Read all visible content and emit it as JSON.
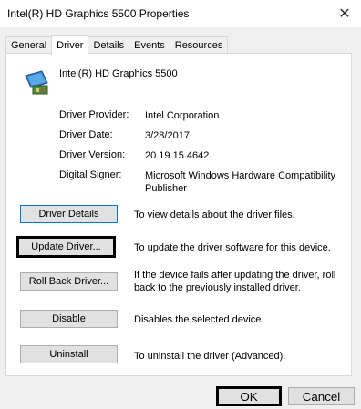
{
  "window": {
    "title": "Intel(R) HD Graphics 5500 Properties",
    "close_glyph": "✕"
  },
  "tabs": [
    {
      "label": "General",
      "active": false
    },
    {
      "label": "Driver",
      "active": true
    },
    {
      "label": "Details",
      "active": false
    },
    {
      "label": "Events",
      "active": false
    },
    {
      "label": "Resources",
      "active": false
    }
  ],
  "device": {
    "name": "Intel(R) HD Graphics 5500",
    "icon": "display-adapter-icon"
  },
  "driver_info": [
    {
      "label": "Driver Provider:",
      "value": "Intel Corporation"
    },
    {
      "label": "Driver Date:",
      "value": "3/28/2017"
    },
    {
      "label": "Driver Version:",
      "value": "20.19.15.4642"
    },
    {
      "label": "Digital Signer:",
      "value": "Microsoft Windows Hardware Compatibility Publisher"
    }
  ],
  "actions": [
    {
      "button": "Driver Details",
      "description": "To view details about the driver files."
    },
    {
      "button": "Update Driver...",
      "description": "To update the driver software for this device."
    },
    {
      "button": "Roll Back Driver...",
      "description": "If the device fails after updating the driver, roll back to the previously installed driver."
    },
    {
      "button": "Disable",
      "description": "Disables the selected device."
    },
    {
      "button": "Uninstall",
      "description": "To uninstall the driver (Advanced)."
    }
  ],
  "footer": {
    "ok_label": "OK",
    "cancel_label": "Cancel"
  }
}
